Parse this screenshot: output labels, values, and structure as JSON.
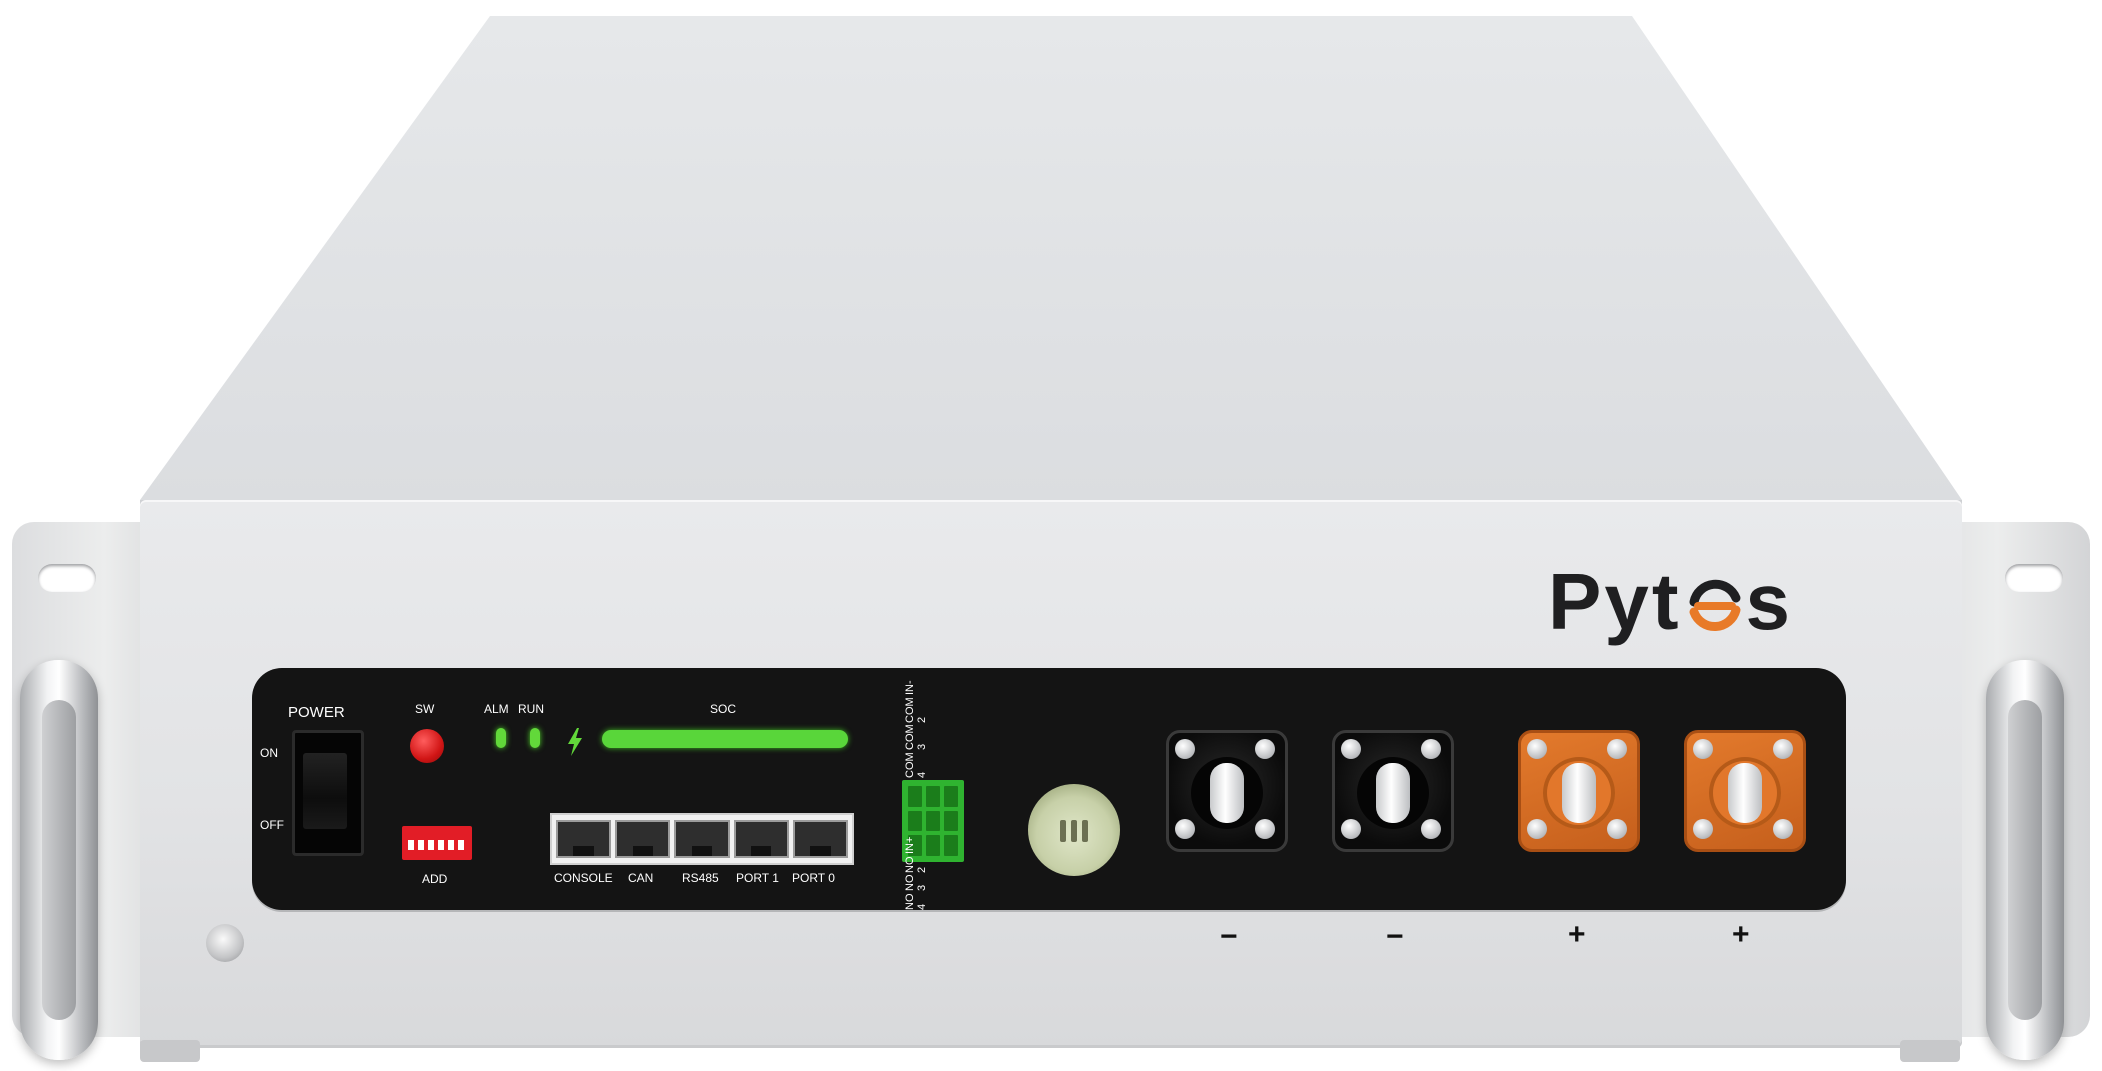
{
  "brand": {
    "logo_text_left": "Pyt",
    "logo_text_right": "s",
    "logo_accent_color": "#e87a28"
  },
  "panel": {
    "power_label": "POWER",
    "on_label": "ON",
    "off_label": "OFF",
    "sw_label": "SW",
    "alm_label": "ALM",
    "run_label": "RUN",
    "soc_label": "SOC",
    "add_label": "ADD",
    "ports": [
      "CONSOLE",
      "CAN",
      "RS485",
      "PORT 1",
      "PORT 0"
    ],
    "terminal_top_labels": [
      "COM 4",
      "COM 3",
      "COM 2",
      "IN-"
    ],
    "terminal_bottom_labels": [
      "NO 4",
      "NO 3",
      "NO 2",
      "IN+"
    ]
  },
  "polarity": {
    "neg_1": "−",
    "neg_2": "−",
    "pos_1": "+",
    "pos_2": "+"
  },
  "colors": {
    "panel": "#141414",
    "led_green": "#62d83a",
    "sw_red": "#e21d26",
    "terminal_orange": "#e37a2c",
    "terminal_block_green": "#2fb330"
  }
}
